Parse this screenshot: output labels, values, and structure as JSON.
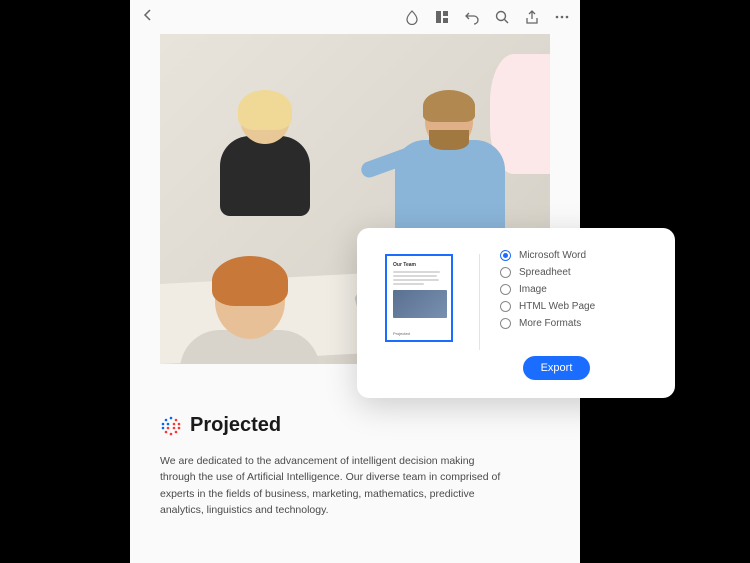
{
  "toolbar": {
    "back_icon": "back-icon",
    "fill_icon": "fill-icon",
    "panel_icon": "panel-icon",
    "undo_icon": "undo-icon",
    "search_icon": "search-icon",
    "share_icon": "share-icon",
    "more_icon": "more-icon"
  },
  "document": {
    "brand_name": "Projected",
    "body_text": "We are dedicated to the advancement of intelligent decision making through the use of Artificial Intelligence. Our diverse team in comprised of experts in the fields of business,  marketing, mathematics, predictive analytics, linguistics and technology."
  },
  "export_panel": {
    "thumbnail": {
      "title": "Our Team",
      "footer_brand": "Projected"
    },
    "options": [
      {
        "label": "Microsoft Word",
        "selected": true
      },
      {
        "label": "Spreadheet",
        "selected": false
      },
      {
        "label": "Image",
        "selected": false
      },
      {
        "label": "HTML Web Page",
        "selected": false
      },
      {
        "label": "More Formats",
        "selected": false
      }
    ],
    "button_label": "Export"
  }
}
